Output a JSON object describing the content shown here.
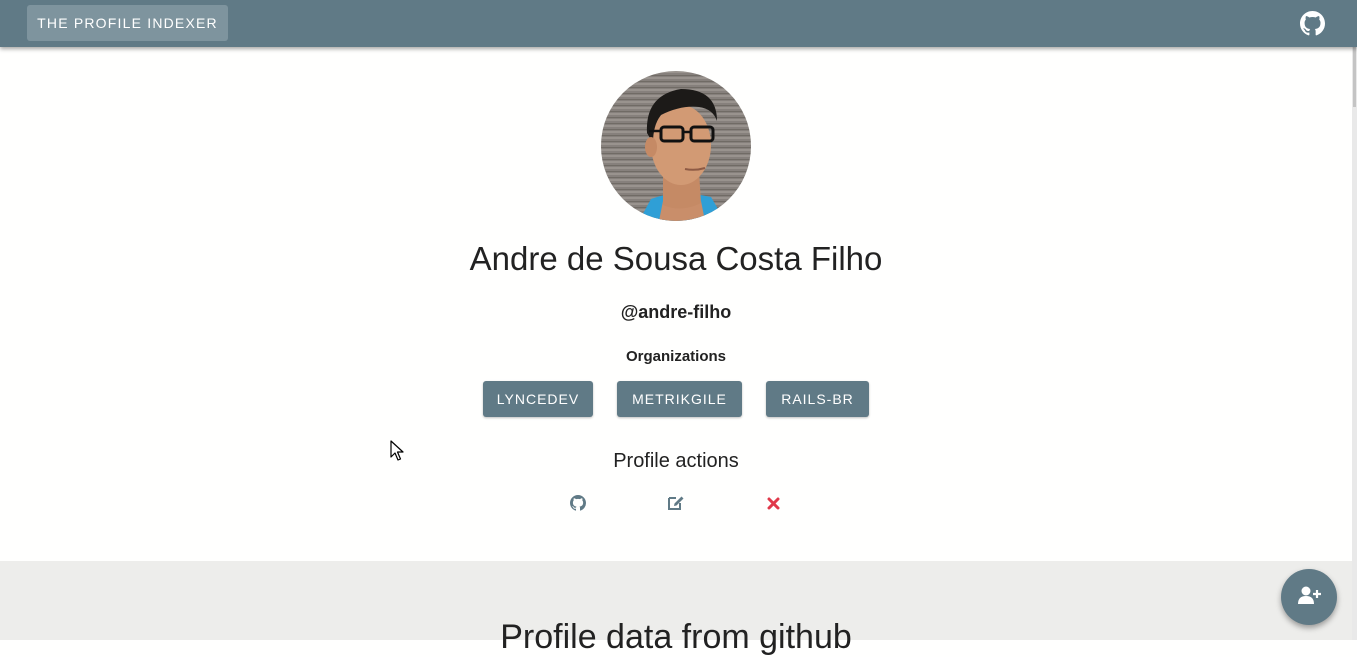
{
  "header": {
    "brand_label": "THE PROFILE INDEXER",
    "github_icon": "github-icon",
    "bar_color": "#607a86"
  },
  "profile": {
    "name": "Andre de Sousa Costa Filho",
    "handle": "@andre-filho",
    "avatar_icon": "profile-photo"
  },
  "organizations": {
    "title": "Organizations",
    "items": [
      {
        "label": "LYNCEDEV"
      },
      {
        "label": "METRIKGILE"
      },
      {
        "label": "RAILS-BR"
      }
    ]
  },
  "actions": {
    "title": "Profile actions",
    "items": [
      {
        "icon": "github-icon",
        "color": "#607a86"
      },
      {
        "icon": "edit-icon",
        "color": "#607a86"
      },
      {
        "icon": "close-icon",
        "color": "#e0394a"
      }
    ]
  },
  "data_section": {
    "title": "Profile data from github"
  },
  "fab": {
    "icon": "add-user-icon",
    "color": "#607a86"
  }
}
